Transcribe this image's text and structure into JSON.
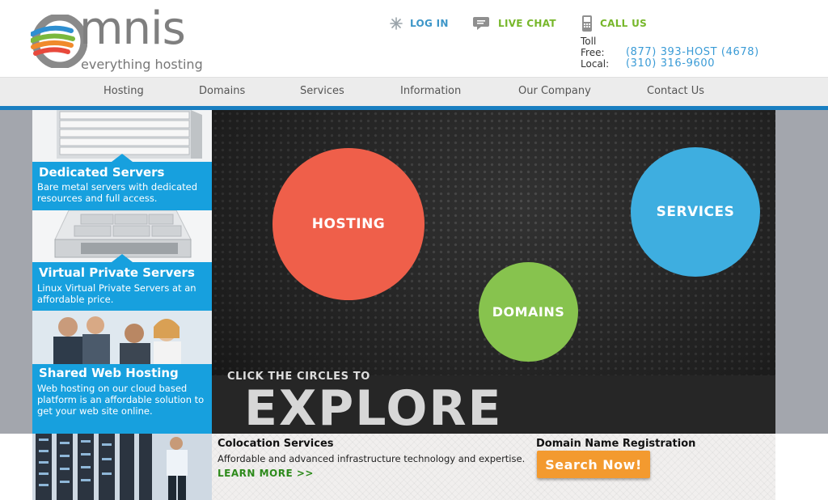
{
  "brand": {
    "logo_word": "mnis",
    "tagline": "everything hosting",
    "swoosh_colors": [
      "#2e8fd1",
      "#7ab83d",
      "#f08a2c",
      "#e8493c"
    ],
    "logo_color": "#7f7f7f"
  },
  "toplinks": {
    "login": {
      "label": "LOG IN",
      "icon": "asterisk-icon"
    },
    "livechat": {
      "label": "LIVE CHAT",
      "icon": "chat-bubble-icon"
    },
    "callus": {
      "label": "CALL US",
      "icon": "phone-icon"
    }
  },
  "phones": {
    "toll_label_1": "Toll",
    "toll_label_2": "Free:",
    "toll_number": "(877) 393-HOST (4678)",
    "local_label": "Local:",
    "local_number": "(310) 316-9600"
  },
  "nav": {
    "items": [
      {
        "label": "Hosting"
      },
      {
        "label": "Domains"
      },
      {
        "label": "Services"
      },
      {
        "label": "Information"
      },
      {
        "label": "Our Company"
      },
      {
        "label": "Contact Us"
      }
    ]
  },
  "panels": [
    {
      "title": "Dedicated Servers",
      "text": "Bare metal servers with dedicated resources and full access."
    },
    {
      "title": "Virtual Private Servers",
      "text": "Linux Virtual Private Servers at an affordable price."
    },
    {
      "title": "Shared Web Hosting",
      "text": "Web hosting on our cloud based platform is an affordable solution to get your web site online."
    }
  ],
  "hero": {
    "circles": {
      "hosting": "HOSTING",
      "domains": "DOMAINS",
      "services": "SERVICES"
    },
    "click_text": "CLICK THE CIRCLES TO",
    "explore": "EXPLORE"
  },
  "strip": {
    "colo_title": "Colocation Services",
    "colo_text": "Affordable and advanced infrastructure technology and expertise.",
    "colo_more": "LEARN MORE >>",
    "domain_title": "Domain Name Registration",
    "search_label": "Search Now!"
  },
  "colors": {
    "accent_blue": "#1a7fc1",
    "panel_blue": "#17a0de",
    "hosting_red": "#ef5f4a",
    "domains_green": "#87c34e",
    "services_blue": "#3eaee0",
    "search_orange": "#f39a2f"
  }
}
